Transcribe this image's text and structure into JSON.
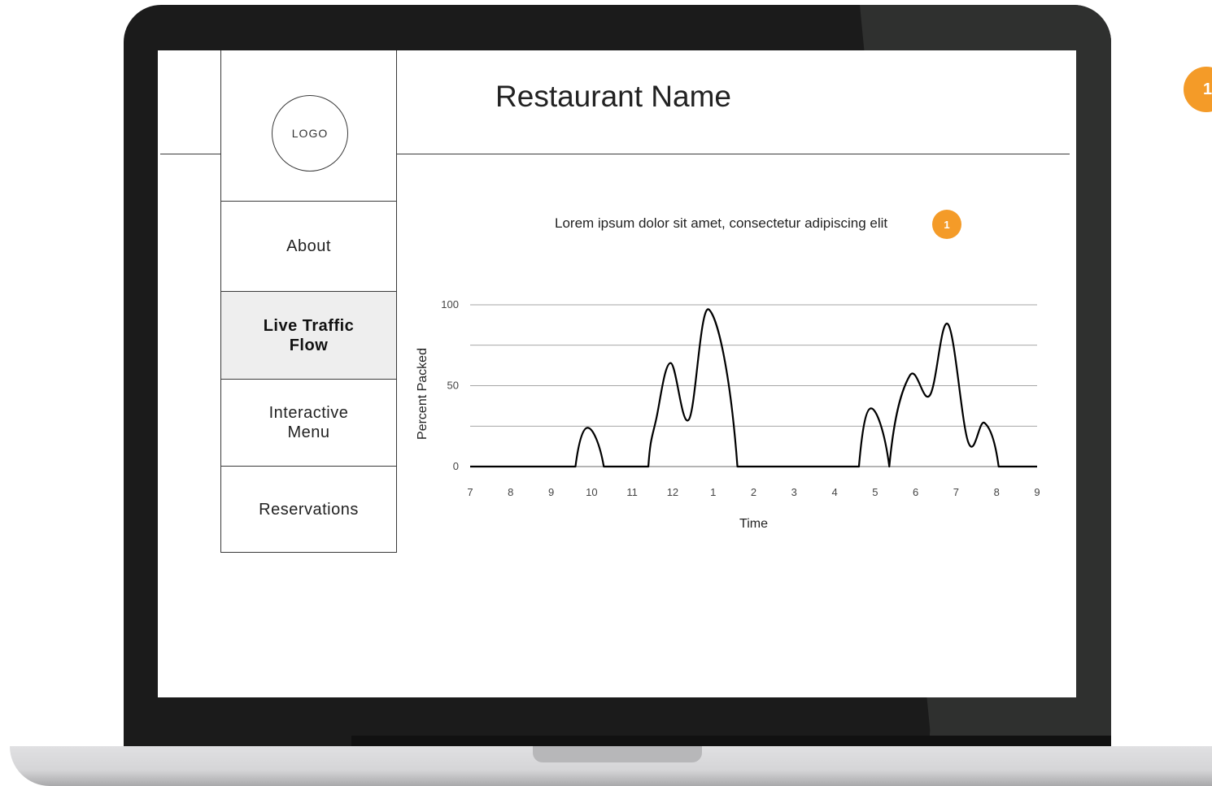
{
  "window": {
    "title": "Restaurant Name"
  },
  "sidebar": {
    "logo_label": "LOGO",
    "items": [
      {
        "label": "About",
        "active": false
      },
      {
        "label": "Live Traffic\nFlow",
        "active": true
      },
      {
        "label": "Interactive\nMenu",
        "active": false
      },
      {
        "label": "Reservations",
        "active": false
      }
    ]
  },
  "main": {
    "subtitle": "Lorem ipsum dolor sit amet, consectetur adipiscing elit",
    "annotation_badge": "1"
  },
  "external_annotation_badge": "1",
  "colors": {
    "accent": "#f49b28",
    "active_nav_bg": "#eeeeee",
    "line": "#000000"
  },
  "chart_data": {
    "type": "line",
    "title": "",
    "xlabel": "Time",
    "ylabel": "Percent Packed",
    "categories": [
      "7",
      "8",
      "9",
      "10",
      "11",
      "12",
      "1",
      "2",
      "3",
      "4",
      "5",
      "6",
      "7",
      "8",
      "9"
    ],
    "ylim": [
      0,
      100
    ],
    "yticks": [
      0,
      50,
      100
    ],
    "grid": true,
    "series": [
      {
        "values_x": [
          0,
          2.6,
          2.9,
          3.3,
          4.4,
          4.6,
          4.95,
          5.4,
          5.9,
          6.6,
          9.6,
          9.9,
          10.35,
          10.85,
          11.35,
          11.8,
          12.3,
          12.7,
          13.05,
          13.4,
          14
        ],
        "values_y": [
          0,
          0,
          24,
          0,
          0,
          30,
          64,
          29,
          97,
          0,
          0,
          36,
          0,
          56,
          44,
          88,
          15,
          27,
          0,
          0,
          0
        ]
      }
    ]
  }
}
